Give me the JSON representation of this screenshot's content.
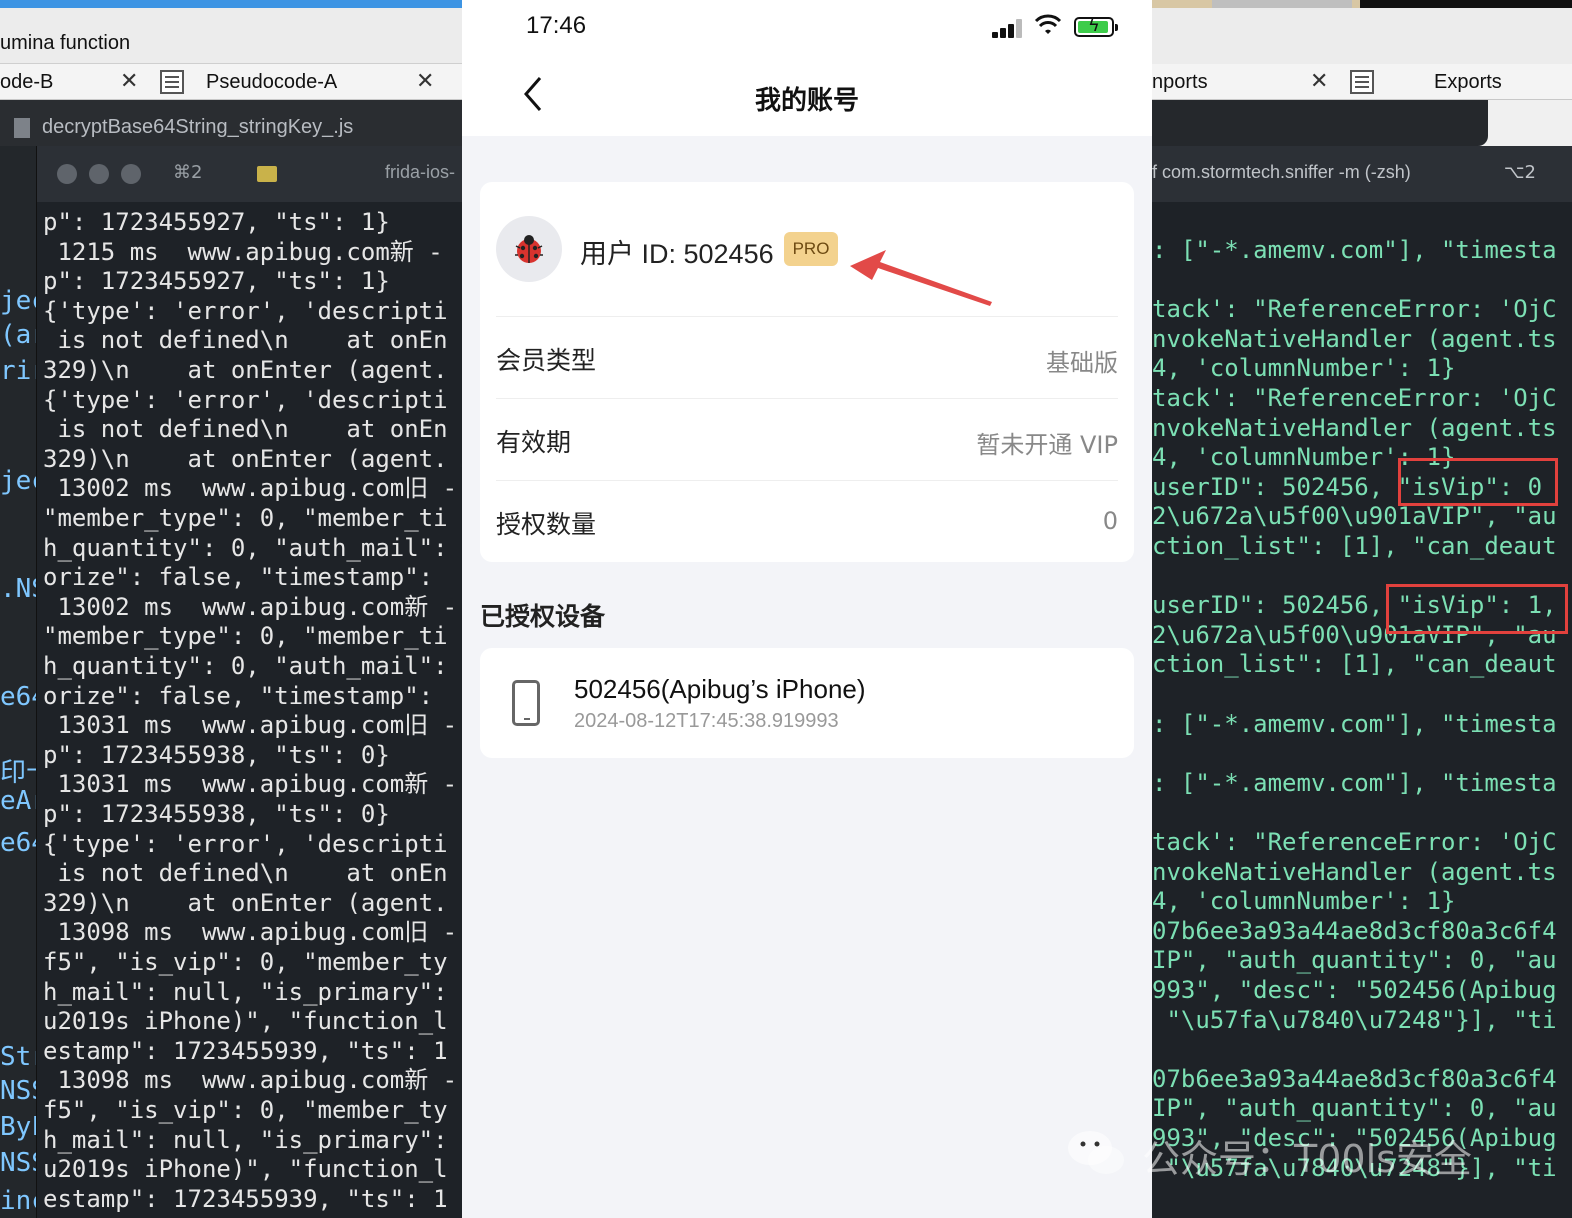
{
  "left": {
    "window_title": "umina function",
    "tabs": [
      {
        "label": "ode-B"
      },
      {
        "label": "Pseudocode-A"
      }
    ],
    "editor_file": "decryptBase64String_stringKey_.js",
    "gutter": [
      "jec",
      "(ar",
      "rir",
      "jec",
      ".NS",
      "e64",
      "印十",
      "eAr",
      "e64",
      "Str",
      "NSS",
      "ByF",
      "NSS",
      "inc"
    ],
    "terminal": {
      "shortcut": "⌘2",
      "title": "frida-ios-",
      "lines": [
        "p\": 1723455927, \"ts\": 1}",
        " 1215 ms  www.apibug.com新 -",
        "p\": 1723455927, \"ts\": 1}",
        "{'type': 'error', 'descripti",
        " is not defined\\n    at onEn",
        "329)\\n    at onEnter (agent.",
        "{'type': 'error', 'descripti",
        " is not defined\\n    at onEn",
        "329)\\n    at onEnter (agent.",
        " 13002 ms  www.apibug.com旧 -",
        "\"member_type\": 0, \"member_ti",
        "h_quantity\": 0, \"auth_mail\":",
        "orize\": false, \"timestamp\": ",
        " 13002 ms  www.apibug.com新 -",
        "\"member_type\": 0, \"member_ti",
        "h_quantity\": 0, \"auth_mail\":",
        "orize\": false, \"timestamp\": ",
        " 13031 ms  www.apibug.com旧 -",
        "p\": 1723455938, \"ts\": 0}",
        " 13031 ms  www.apibug.com新 -",
        "p\": 1723455938, \"ts\": 0}",
        "{'type': 'error', 'descripti",
        " is not defined\\n    at onEn",
        "329)\\n    at onEnter (agent.",
        " 13098 ms  www.apibug.com旧 -",
        "f5\", \"is_vip\": 0, \"member_ty",
        "h_mail\": null, \"is_primary\":",
        "u2019s iPhone)\", \"function_l",
        "estamp\": 1723455939, \"ts\": 1",
        " 13098 ms  www.apibug.com新 -",
        "f5\", \"is_vip\": 0, \"member_ty",
        "h_mail\": null, \"is_primary\":",
        "u2019s iPhone)\", \"function_l",
        "estamp\": 1723455939, \"ts\": 1"
      ]
    }
  },
  "phone": {
    "status_time": "17:46",
    "nav_title": "我的账号",
    "user_id": "用户 ID: 502456",
    "badge": "PRO",
    "rows": [
      {
        "label": "会员类型",
        "value": "基础版"
      },
      {
        "label": "有效期",
        "value": "暂未开通 VIP"
      },
      {
        "label": "授权数量",
        "value": "0"
      }
    ],
    "devices_title": "已授权设备",
    "device": {
      "name": "502456(Apibug’s iPhone)",
      "time": "2024-08-12T17:45:38.919993"
    }
  },
  "right": {
    "tabs": [
      {
        "label": "nports"
      },
      {
        "label": "Exports"
      }
    ],
    "terminal": {
      "title": "f com.stormtech.sniffer -m (-zsh)",
      "shortcut": "⌥2",
      "lines": [
        ": [\"-*.amemv.com\"], \"timesta",
        "",
        "tack': \"ReferenceError: 'OjC",
        "nvokeNativeHandler (agent.ts",
        "4, 'columnNumber': 1}",
        "tack': \"ReferenceError: 'OjC",
        "nvokeNativeHandler (agent.ts",
        "4, 'columnNumber': 1}",
        "userID\": 502456, \"isVip\": 0",
        "2\\u672a\\u5f00\\u901aVIP\", \"au",
        "ction_list\": [1], \"can_deaut",
        "",
        "userID\": 502456, \"isVip\": 1,",
        "2\\u672a\\u5f00\\u901aVIP\", \"au",
        "ction_list\": [1], \"can_deaut",
        "",
        ": [\"-*.amemv.com\"], \"timesta",
        "",
        ": [\"-*.amemv.com\"], \"timesta",
        "",
        "tack': \"ReferenceError: 'OjC",
        "nvokeNativeHandler (agent.ts",
        "4, 'columnNumber': 1}",
        "07b6ee3a93a44ae8d3cf80a3c6f4",
        "IP\", \"auth_quantity\": 0, \"au",
        "993\", \"desc\": \"502456(Apibug",
        " \"\\u57fa\\u7840\\u7248\"}], \"ti",
        "",
        "07b6ee3a93a44ae8d3cf80a3c6f4",
        "IP\", \"auth_quantity\": 0, \"au",
        "993\", \"desc\": \"502456(Apibug",
        " \"\\u57fa\\u7840\\u7248\"}], \"ti"
      ]
    }
  },
  "watermark": "公众号：T00ls安全",
  "colors": {
    "highlight": "#e2413d",
    "terminal_green": "#7ce0b4",
    "pro_badge": "#f3d28e"
  }
}
